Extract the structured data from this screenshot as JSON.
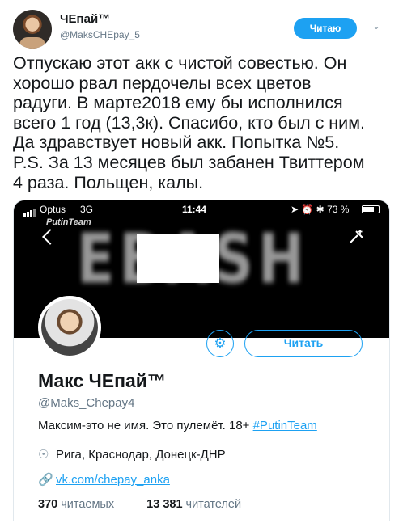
{
  "tweet": {
    "author_name": "ЧЕпай™",
    "author_handle": "@MaksCHEpay_5",
    "follow_label": "Читаю",
    "text": "Отпускаю этот акк с чистой совестью. Он\nхорошо рвал пердочелы всех цветов\nрадуги. В марте2018 ему бы исполнился\nвсего 1 год (13,3к). Спасибо, кто был с ним.\nДа здравствует новый акк. Попытка №5.\nP.S. За 13 месяцев был забанен Твиттером\n4 раза. Польщен, калы."
  },
  "screenshot": {
    "status_bar": {
      "carrier": "Optus",
      "network": "3G",
      "time": "11:44",
      "battery": "73 %",
      "battery_level": 0.73
    },
    "banner": {
      "brand": "PutinTeam",
      "word": "EBASH"
    },
    "profile": {
      "name": "Макс ЧЕпай™",
      "handle": "@Maks_Chepay4",
      "follow_label": "Читать",
      "bio_text": "Максим-это не имя. Это пулемёт. 18+ ",
      "bio_tag": "#PutinTeam",
      "location": "Рига, Краснодар, Донецк-ДНР",
      "link": "vk.com/chepay_anka",
      "following_count": "370",
      "following_label": "читаемых",
      "followers_count": "13 381",
      "followers_label": "читателей"
    }
  },
  "icons": {
    "caret": "chevron-down-icon",
    "gear": "gear-icon",
    "location": "location-pin-icon",
    "link": "link-icon",
    "back": "back-arrow-icon",
    "compose": "compose-icon"
  },
  "colors": {
    "accent": "#1da1f2",
    "secondary_text": "#657786",
    "primary_text": "#14171a"
  }
}
